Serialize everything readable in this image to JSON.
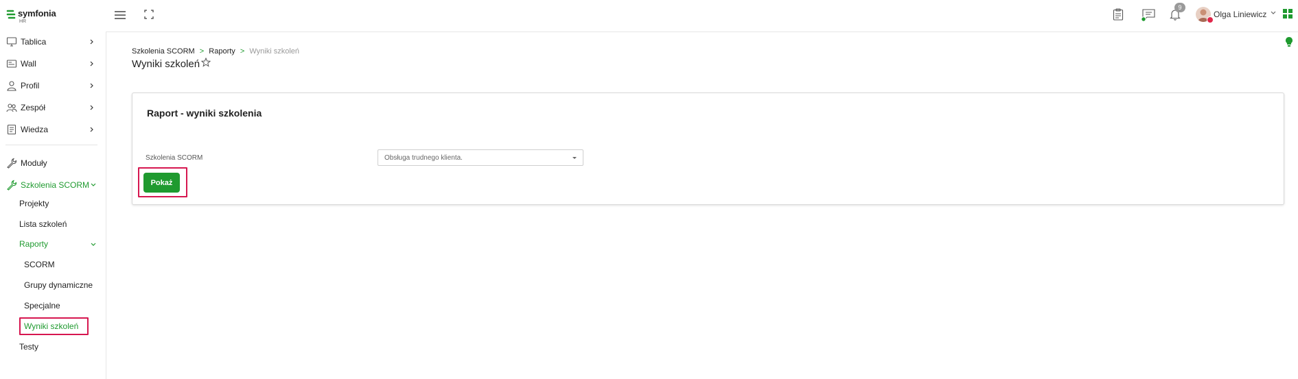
{
  "header": {
    "logo_text": "symfonia",
    "logo_sub": "HR",
    "notifications_count": "9",
    "user_name": "Olga Liniewicz"
  },
  "sidebar": {
    "items": [
      {
        "label": "Tablica",
        "icon": "monitor-icon"
      },
      {
        "label": "Wall",
        "icon": "wall-icon"
      },
      {
        "label": "Profil",
        "icon": "user-icon"
      },
      {
        "label": "Zespół",
        "icon": "team-icon"
      },
      {
        "label": "Wiedza",
        "icon": "document-icon"
      },
      {
        "label": "Moduły",
        "icon": "wrench-icon"
      },
      {
        "label": "Szkolenia SCORM",
        "icon": "wrench-icon"
      }
    ],
    "sub_items": {
      "projekty": "Projekty",
      "lista": "Lista szkoleń",
      "raporty": "Raporty",
      "scorm": "SCORM",
      "grupy": "Grupy dynamiczne",
      "specjalne": "Specjalne",
      "wyniki": "Wyniki szkoleń",
      "testy": "Testy"
    }
  },
  "breadcrumb": {
    "item1": "Szkolenia SCORM",
    "item2": "Raporty",
    "current": "Wyniki szkoleń",
    "separator": ">"
  },
  "page": {
    "title": "Wyniki szkoleń"
  },
  "card": {
    "title": "Raport - wyniki szkolenia",
    "field_label": "Szkolenia SCORM",
    "select_value": "Obsługa trudnego klienta.",
    "button_label": "Pokaż"
  },
  "colors": {
    "accent": "#1f9a2f",
    "highlight": "#d6164f"
  }
}
